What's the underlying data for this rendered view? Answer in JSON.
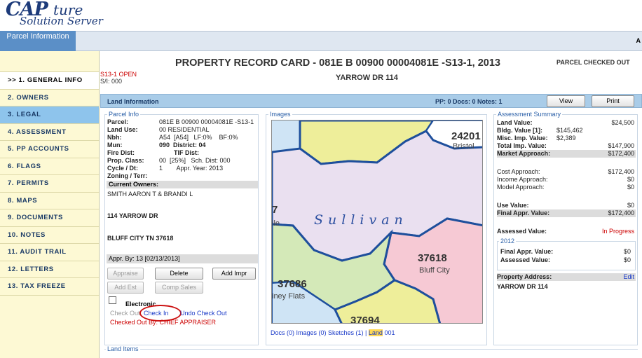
{
  "header": {
    "logo_main": "CAP",
    "logo_script": "ture",
    "logo_sub": "Solution Server",
    "tab_label": "Parcel Information",
    "right_letter": "A"
  },
  "nav": {
    "items": [
      {
        "label": ">> 1. GENERAL INFO"
      },
      {
        "label": "2. OWNERS"
      },
      {
        "label": "3. LEGAL"
      },
      {
        "label": "4. ASSESSMENT"
      },
      {
        "label": "5. PP ACCOUNTS"
      },
      {
        "label": "6. FLAGS"
      },
      {
        "label": "7. PERMITS"
      },
      {
        "label": "8. MAPS"
      },
      {
        "label": "9. DOCUMENTS"
      },
      {
        "label": "10. NOTES"
      },
      {
        "label": "11. AUDIT TRAIL"
      },
      {
        "label": "12. LETTERS"
      },
      {
        "label": "13. TAX FREEZE"
      }
    ]
  },
  "record": {
    "title": "PROPERTY RECORD CARD - 081E B 00900 00004081E -S13-1, 2013",
    "checked_status": "PARCEL CHECKED OUT",
    "status_code": "S13-1 OPEN",
    "si": "S/I: 000",
    "address_heading": "YARROW DR 114"
  },
  "land_bar": {
    "label": "Land Information",
    "counts": "PP: 0   Docs: 0   Notes: 1",
    "view_label": "View",
    "print_label": "Print"
  },
  "parcel_info": {
    "legend": "Parcel Info",
    "parcel_label": "Parcel:",
    "parcel_value": "081E B 00900 00004081E -S13-1",
    "land_use_label": "Land Use:",
    "land_use_value": "00 RESIDENTIAL",
    "nbh_label": "Nbh:",
    "nbh_value": "A54  [A54]   LF:0%    BF:0%",
    "mun_label": "Mun:",
    "mun_value": "090  District: 04",
    "fire_label": "Fire Dist:",
    "tif_label": "TIF Dist:",
    "prop_class_label": "Prop. Class:",
    "prop_class_value": "00  [25%]   Sch. Dist: 000",
    "cycle_label": "Cycle / Dt:",
    "cycle_value": "1        Appr. Year: 2013",
    "zoning_label": "Zoning / Terr:",
    "owners_label": "Current Owners:",
    "owner_name": "SMITH AARON T & BRANDI L",
    "owner_street": "114 YARROW DR",
    "owner_city": "BLUFF CITY TN 37618",
    "appr_by": "Appr. By: 13 [02/13/2013]",
    "btn_appraise": "Appraise",
    "btn_delete": "Delete",
    "btn_add_impr": "Add Impr",
    "btn_add_est": "Add Est",
    "btn_comp_sales": "Comp Sales",
    "electronic_label": "Electronic",
    "check_out": "Check Out",
    "check_in": "Check In",
    "undo_check_out": "Undo Check Out",
    "checked_out_by": "Checked Out By: CHIEF APPRAISER"
  },
  "images": {
    "legend": "Images",
    "map_labels": {
      "zip_24201": "24201",
      "bristol": "Bristol",
      "sullivan": "Sullivan",
      "zip_37618": "37618",
      "bluff_city": "Bluff City",
      "zip_37686": "37686",
      "piney_flats": "iney Flats",
      "zip_37694": "37694",
      "ile": "ile",
      "seven": "7"
    },
    "links_prefix": "Docs (0)  Images (0)  Sketches (1)  |",
    "land_link": "Land",
    "land_num": "001"
  },
  "assessment": {
    "legend": "Assessment Summary",
    "land_value_label": "Land Value:",
    "land_value": "$24,500",
    "bldg_label": "Bldg. Value [1]:",
    "bldg_value": "$145,462",
    "misc_label": "Misc. Imp. Value:",
    "misc_value": "$2,389",
    "total_imp_label": "Total Imp. Value:",
    "total_imp_value": "$147,900",
    "market_label": "Market Approach:",
    "market_value": "$172,400",
    "cost_label": "Cost Approach:",
    "cost_value": "$172,400",
    "income_label": "Income Approach:",
    "income_value": "$0",
    "model_label": "Model Approach:",
    "model_value": "$0",
    "use_label": "Use Value:",
    "use_value": "$0",
    "final_label": "Final Appr. Value:",
    "final_value": "$172,400",
    "assessed_label": "Assessed Value:",
    "assessed_value": "In Progress",
    "year": "2012",
    "prev_final_label": "Final Appr. Value:",
    "prev_final_value": "$0",
    "prev_assessed_label": "Assessed Value:",
    "prev_assessed_value": "$0",
    "prop_addr_label": "Property Address:",
    "edit_label": "Edit",
    "prop_addr_value": "YARROW DR 114"
  },
  "land_items": {
    "legend": "Land Items"
  },
  "colors": {
    "accent_blue": "#5b8fc7",
    "nav_active": "#8ec4ec",
    "nav_bg": "#fdf9d4",
    "alert_red": "#cc0000",
    "link_blue": "#1a3ac8"
  }
}
